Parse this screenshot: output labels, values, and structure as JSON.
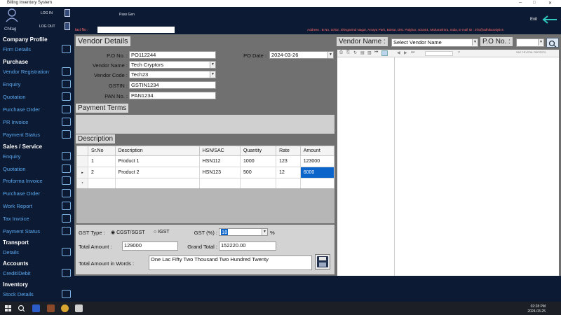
{
  "window": {
    "title": "Billing Inventory System"
  },
  "header": {
    "user_name": "Chitag",
    "login_label": "LOG IN",
    "logout_label": "LOG OUT",
    "pass_gen_label": "Pass Gen",
    "contact_prefix": "tact No :",
    "address_text": "Address : B.No. 10/02, Shivganind Nagar, Amaya Park, Boisar, Dist. Palghar, 401501, Maharashtra, India,   E-mail ID : info@adhikanalytics",
    "exit_label": "Exit"
  },
  "sidebar": {
    "sections": [
      {
        "heading": "Company Profile",
        "items": [
          "Firm Details"
        ]
      },
      {
        "heading": "Purchase",
        "items": [
          "Vendor Registration",
          "Enquiry",
          "Quotation",
          "Purchase Order",
          "PR Invoice",
          "Payment Status"
        ]
      },
      {
        "heading": "Sales /  Service",
        "items": [
          "Enquiry",
          "Quotation",
          "Proforma Invoice",
          "Purchase Order",
          "Work Report",
          "Tax Invoice",
          "Payment Status"
        ]
      },
      {
        "heading": "Transport",
        "items": [
          "Details"
        ]
      },
      {
        "heading": "Accounts",
        "items": [
          "Credit/Debit"
        ]
      },
      {
        "heading": "Inventory",
        "items": [
          "Stock Details"
        ]
      }
    ]
  },
  "vendor_details": {
    "title": "Vendor Details",
    "po_no_label": "P.O No. :",
    "po_no_value": "PO112244",
    "po_date_label": "PO Date :",
    "po_date_value": "2024-03-26",
    "vendor_name_label": "Vendor Name :",
    "vendor_name_value": "Tech Cryptors",
    "vendor_code_label": "Vendor Code :",
    "vendor_code_value": "Tech23",
    "gstin_label": "GSTIN :",
    "gstin_value": "GSTIN1234",
    "pan_label": "PAN No. :",
    "pan_value": "PAN1234"
  },
  "payment_terms": {
    "title": "Payment Terms"
  },
  "description": {
    "title": "Description",
    "columns": [
      "Sr.No",
      "Description",
      "HSN/SAC",
      "Quantity",
      "Rate",
      "Amount"
    ],
    "rows": [
      [
        "1",
        "Product 1",
        "HSN112",
        "1000",
        "123",
        "123000"
      ],
      [
        "2",
        "Product 2",
        "HSN123",
        "500",
        "12",
        "6000"
      ]
    ],
    "new_row_marker": "*"
  },
  "totals": {
    "gst_type_label": "GST Type :",
    "cgst_option": "CGST/SGST",
    "igst_option": "IGST",
    "gst_pct_label": "GST (%) :",
    "gst_pct_value": "18",
    "pct_symbol": "%",
    "total_amount_label": "Total Amount :",
    "total_amount_value": "129000",
    "grand_total_label": "Grand Total :",
    "grand_total_value": "152220.00",
    "words_label": "Total Amount in Words :",
    "words_value": "One Lac Fifty Two Thousand Two Hundred Twenty"
  },
  "report_panel": {
    "vendor_name_label": "Vendor Name :",
    "vendor_select_value": "Select Vendor Name",
    "po_no_label": "P.O No. :",
    "brand_text": "SAP CRYSTAL REPORTS"
  },
  "taskbar": {
    "time": "02:28 PM",
    "date": "2024-03-25"
  }
}
